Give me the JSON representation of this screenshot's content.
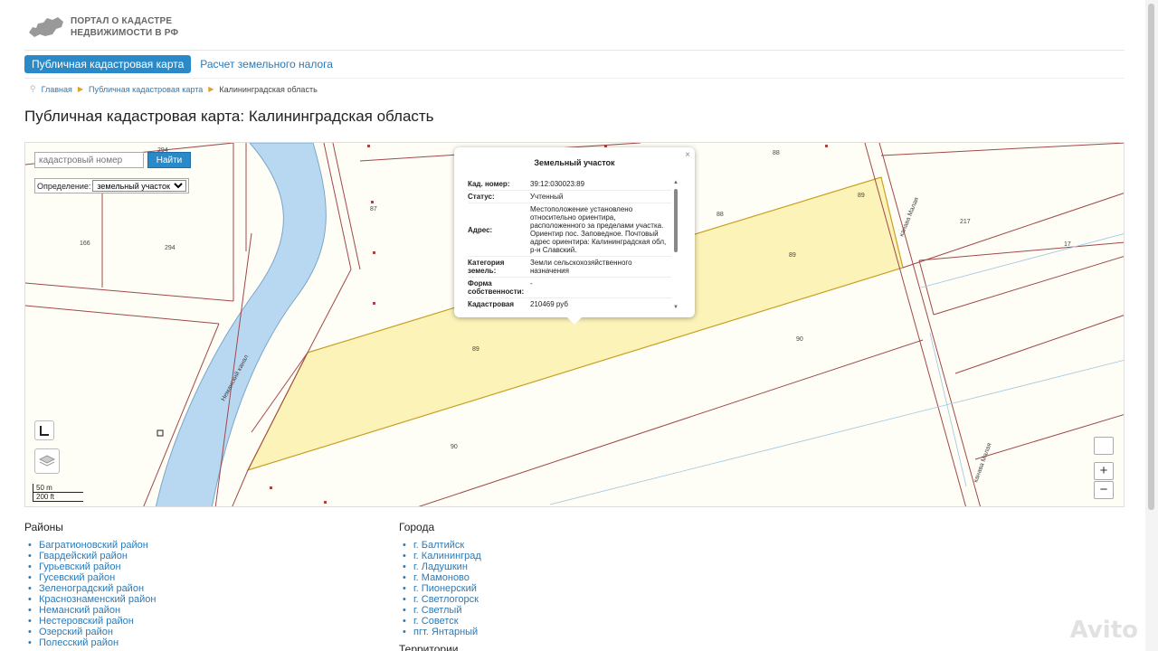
{
  "header": {
    "logo_line1": "ПОРТАЛ О КАДАСТРЕ",
    "logo_line2": "НЕДВИЖИМОСТИ В РФ"
  },
  "tabs": [
    {
      "label": "Публичная кадастровая карта",
      "active": true
    },
    {
      "label": "Расчет земельного налога",
      "active": false
    }
  ],
  "breadcrumb": [
    "Главная",
    "Публичная кадастровая карта",
    "Калининградская область"
  ],
  "page_title": "Публичная кадастровая карта: Калининградская область",
  "map": {
    "search_placeholder": "кадастровый номер",
    "search_button": "Найти",
    "definition_label": "Определение:",
    "definition_value": "земельный участок",
    "scale_m": "50 m",
    "scale_ft": "200 ft",
    "zoom_in": "+",
    "zoom_out": "−",
    "labels": [
      "294",
      "87",
      "88",
      "166",
      "294",
      "89",
      "88",
      "217",
      "17",
      "89",
      "89",
      "90",
      "90",
      "канава Малая",
      "Неманский канал",
      "канава Малая"
    ],
    "popup": {
      "title": "Земельный участок",
      "close": "×",
      "rows": [
        {
          "key": "Кад. номер:",
          "value": "39:12:030023:89"
        },
        {
          "key": "Статус:",
          "value": "Учтенный"
        },
        {
          "key": "Адрес:",
          "value": "Местоположение установлено относительно ориентира, расположенного за пределами участка. Ориентир пос. Заповедное. Почтовый адрес ориентира: Калининградская обл, р-н Славский."
        },
        {
          "key": "Категория земель:",
          "value": "Земли сельскохозяйственного назначения"
        },
        {
          "key": "Форма собственности:",
          "value": "-"
        },
        {
          "key": "Кадастровая стоимость:",
          "value": "210469 руб"
        }
      ]
    },
    "colors": {
      "parcel_fill": "#fbf3b8",
      "canal": "#b8d8f2",
      "boundary": "#a04848",
      "background": "#fffef6"
    }
  },
  "districts": {
    "title": "Районы",
    "items": [
      "Багратионовский район",
      "Гвардейский район",
      "Гурьевский район",
      "Гусевский район",
      "Зеленоградский район",
      "Краснознаменский район",
      "Неманский район",
      "Нестеровский район",
      "Озерский район",
      "Полесский район"
    ]
  },
  "cities": {
    "title": "Города",
    "items": [
      "г. Балтийск",
      "г. Калининград",
      "г. Ладушкин",
      "г. Мамоново",
      "г. Пионерский",
      "г. Светлогорск",
      "г. Светлый",
      "г. Советск",
      "пгт. Янтарный"
    ]
  },
  "territories_title": "Территории",
  "watermark": "Avito"
}
